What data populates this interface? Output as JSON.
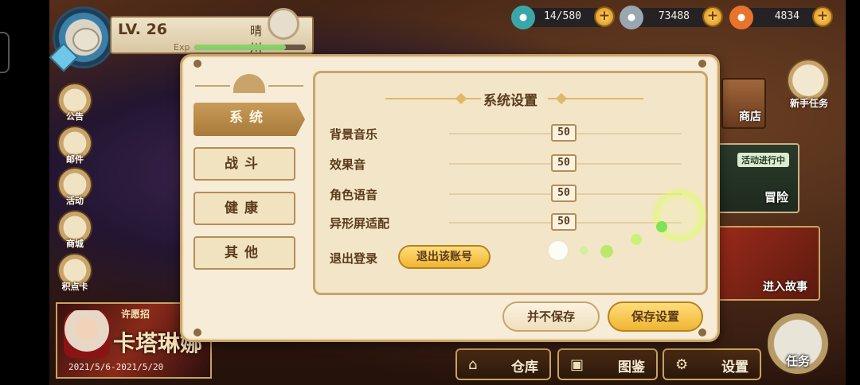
{
  "player": {
    "level": "LV. 26",
    "name": "晴川",
    "exp_label": "Exp",
    "exp_progress": 0.82
  },
  "resources": [
    {
      "icon": "stamina-potion-icon",
      "value": "14/580",
      "color": "#3aa6a8"
    },
    {
      "icon": "gem-coin-icon",
      "value": "73488",
      "color": "#9aa6b0"
    },
    {
      "icon": "carrot-icon",
      "value": "4834",
      "color": "#e8732a"
    }
  ],
  "side_menu": [
    "公告",
    "邮件",
    "活动",
    "商城",
    "积点卡"
  ],
  "banner": {
    "title": "许愿招",
    "name": "卡塔琳娜",
    "date": "2021/5/6-2021/5/20"
  },
  "right_menu": {
    "new_task": "新手任务",
    "shop": "商店",
    "adventure_tag": "活动进行中",
    "adventure": "冒险",
    "story": "进入故事",
    "task": "任务"
  },
  "bottom_bar": [
    "仓库",
    "图鉴",
    "设置"
  ],
  "settings": {
    "title": "系统设置",
    "tabs": [
      "系统",
      "战斗",
      "健康",
      "其他"
    ],
    "active_tab": 0,
    "sliders": [
      {
        "label": "背景音乐",
        "value": 50
      },
      {
        "label": "效果音",
        "value": 50
      },
      {
        "label": "角色语音",
        "value": 50
      },
      {
        "label": "异形屏适配",
        "value": 50
      }
    ],
    "logout_label": "退出登录",
    "logout_button": "退出该账号",
    "no_save_button": "并不保存",
    "save_button": "保存设置"
  }
}
